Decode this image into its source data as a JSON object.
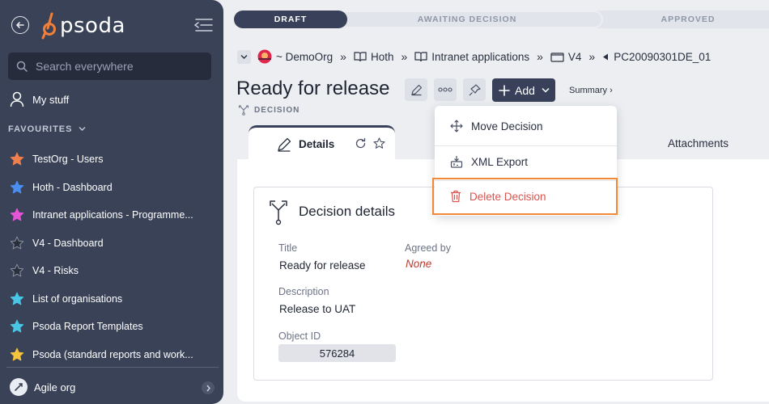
{
  "sidebar": {
    "logo_text": "psoda",
    "search": {
      "placeholder": "Search everywhere"
    },
    "my_stuff_label": "My stuff",
    "favourites_heading": "FAVOURITES",
    "favourites": [
      {
        "label": "TestOrg - Users",
        "star_color": "#f07f4c"
      },
      {
        "label": "Hoth - Dashboard",
        "star_color": "#4a8ef0"
      },
      {
        "label": "Intranet applications - Programme...",
        "star_color": "#e655d8"
      },
      {
        "label": "V4 - Dashboard",
        "star_color": "#2a2f3c"
      },
      {
        "label": "V4 - Risks",
        "star_color": "#2a2f3c"
      },
      {
        "label": "List of organisations",
        "star_color": "#49c6e5"
      },
      {
        "label": "Psoda Report Templates",
        "star_color": "#49c6e5"
      },
      {
        "label": "Psoda (standard reports and work...",
        "star_color": "#f5c43c"
      }
    ],
    "org_label": "Agile org"
  },
  "status": {
    "steps": [
      "DRAFT",
      "AWAITING DECISION",
      "APPROVED"
    ],
    "active": "DRAFT"
  },
  "breadcrumb": {
    "items": [
      "~ DemoOrg",
      "Hoth",
      "Intranet applications",
      "V4"
    ],
    "separator": "»",
    "current": "PC20090301DE_01"
  },
  "page": {
    "title": "Ready for release",
    "type": "DECISION",
    "add_label": "Add",
    "summary_label": "Summary ›"
  },
  "tabs": {
    "active": "Details",
    "other": "Attachments"
  },
  "menu": {
    "move": "Move Decision",
    "export": "XML Export",
    "delete": "Delete Decision"
  },
  "details": {
    "heading": "Decision details",
    "title_label": "Title",
    "title_value": "Ready for release",
    "agreed_label": "Agreed by",
    "agreed_value": "None",
    "description_label": "Description",
    "description_value": "Release to UAT",
    "objid_label": "Object ID",
    "objid_value": "576284"
  },
  "colors": {
    "sidebar_bg": "#3a4257",
    "accent": "#39415a",
    "highlight": "#f08a3a",
    "danger": "#d9534f",
    "logo_orange": "#f07f3a"
  },
  "icons": [
    "back-icon",
    "collapse-icon",
    "search-icon",
    "user-icon",
    "chevron-down-icon",
    "star-icon",
    "org-icon",
    "chevron-right-icon",
    "pencil-icon",
    "more-icon",
    "bell-icon",
    "plus-icon",
    "decision-icon",
    "refresh-icon",
    "move-icon",
    "xml-export-icon",
    "trash-icon",
    "book-icon",
    "folder-icon"
  ]
}
